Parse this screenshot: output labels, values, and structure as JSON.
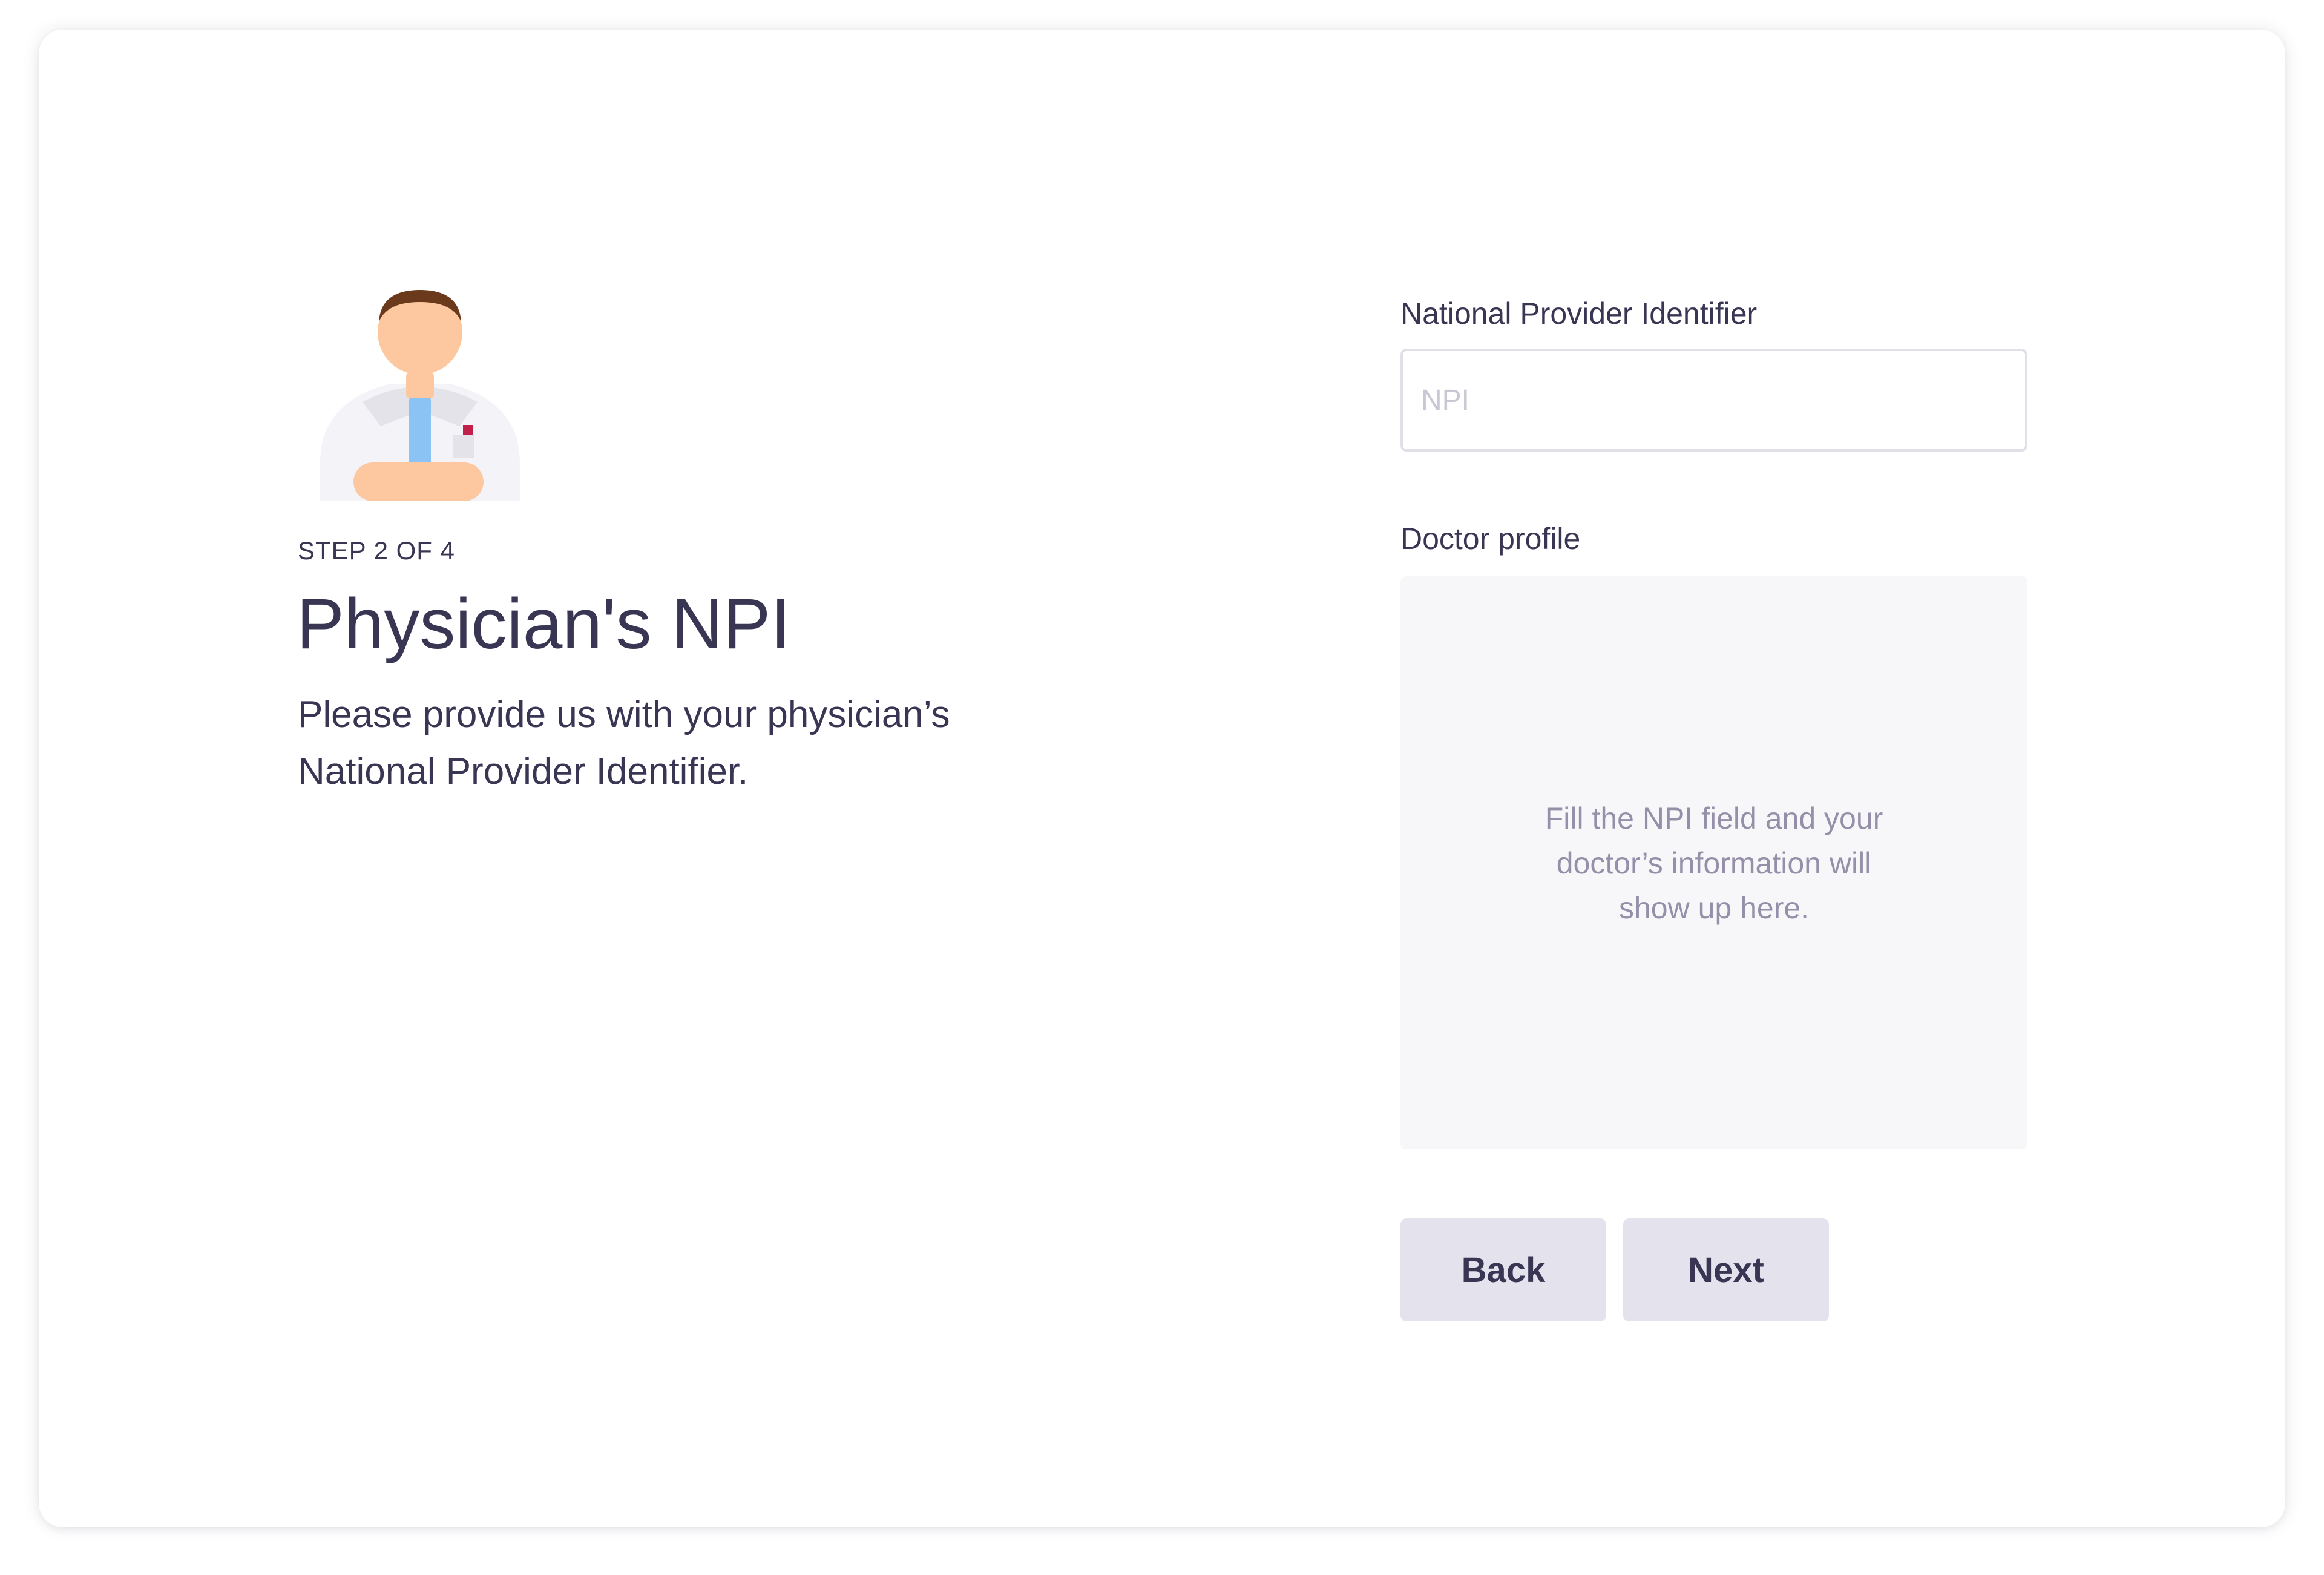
{
  "wizard": {
    "step_label": "STEP 2 OF 4",
    "title": "Physician's NPI",
    "description": "Please provide us with your physician’s National Provider Identifier.",
    "illustration_icon": "doctor-icon"
  },
  "form": {
    "npi_label": "National Provider Identifier",
    "npi_placeholder": "NPI",
    "npi_value": "",
    "profile_label": "Doctor profile",
    "profile_placeholder": "Fill the NPI field and your doctor’s information will show up here."
  },
  "actions": {
    "back_label": "Back",
    "next_label": "Next"
  },
  "colors": {
    "text_primary": "#393654",
    "text_muted": "#958fa9",
    "button_bg": "#e4e2ed",
    "panel_bg": "#f7f7f9",
    "input_border": "#e1dfe8"
  }
}
